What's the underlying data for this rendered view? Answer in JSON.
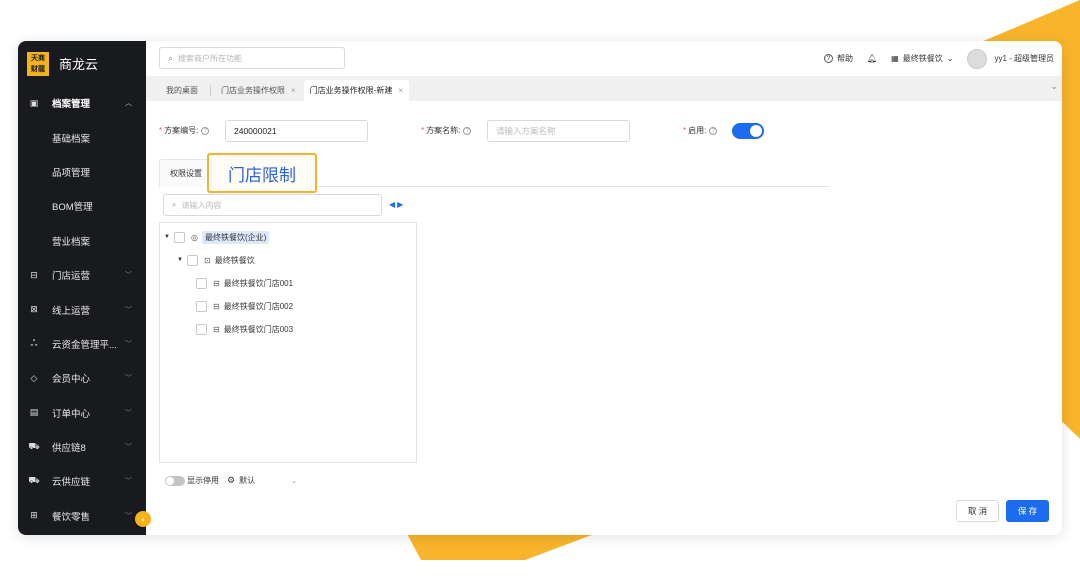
{
  "colors": {
    "accent": "#1c6cf0",
    "brand": "#f4b21b",
    "sidebar_bg": "#191a1d",
    "required": "#ff4d4f"
  },
  "logo": {
    "mark_line1": "天商",
    "mark_line2": "财龍",
    "text": "商龙云"
  },
  "sidebar": {
    "items": [
      {
        "label": "档案管理",
        "icon": "archive-icon",
        "open": true
      },
      {
        "label": "基础档案",
        "sub": true
      },
      {
        "label": "品项管理",
        "sub": true
      },
      {
        "label": "BOM管理",
        "sub": true
      },
      {
        "label": "营业档案",
        "sub": true
      },
      {
        "label": "门店运营",
        "icon": "store-icon"
      },
      {
        "label": "线上运营",
        "icon": "online-icon"
      },
      {
        "label": "云资金管理平...",
        "icon": "org-icon"
      },
      {
        "label": "会员中心",
        "icon": "member-icon"
      },
      {
        "label": "订单中心",
        "icon": "order-icon"
      },
      {
        "label": "供应链8",
        "icon": "truck-icon"
      },
      {
        "label": "云供应链",
        "icon": "truck-icon"
      },
      {
        "label": "餐饮零售",
        "icon": "cart-icon"
      }
    ],
    "collapse_icon": "chevron-left-icon"
  },
  "topbar": {
    "search_placeholder": "搜索商户所在功能",
    "help": "帮助",
    "org": "最终铁餐饮",
    "user": "yy1 - 超级管理员"
  },
  "tabs": [
    {
      "label": "我的桌面",
      "closable": false
    },
    {
      "label": "门店业务操作权限",
      "closable": true
    },
    {
      "label": "门店业务操作权限-新建",
      "closable": true,
      "active": true
    }
  ],
  "form": {
    "code_label": "方案编号:",
    "code_value": "240000021",
    "name_label": "方案名称:",
    "name_placeholder": "请输入方案名称",
    "enable_label": "启用:",
    "enabled": true
  },
  "subtab_label": "权限设置",
  "callout": "门店限制",
  "tree": {
    "search_placeholder": "请输入内容",
    "nodes": [
      {
        "label": "最终铁餐饮(企业)",
        "level": 0,
        "expanded": true,
        "icon": "enterprise-icon",
        "highlight": true
      },
      {
        "label": "最终铁餐饮",
        "level": 1,
        "expanded": true,
        "icon": "brand-icon"
      },
      {
        "label": "最终铁餐饮门店001",
        "level": 2,
        "icon": "store-icon"
      },
      {
        "label": "最终铁餐饮门店002",
        "level": 2,
        "icon": "store-icon"
      },
      {
        "label": "最终铁餐饮门店003",
        "level": 2,
        "icon": "store-icon"
      }
    ]
  },
  "bottom": {
    "show_disabled": "显示停用",
    "default": "默认"
  },
  "buttons": {
    "cancel": "取 消",
    "save": "保 存"
  }
}
